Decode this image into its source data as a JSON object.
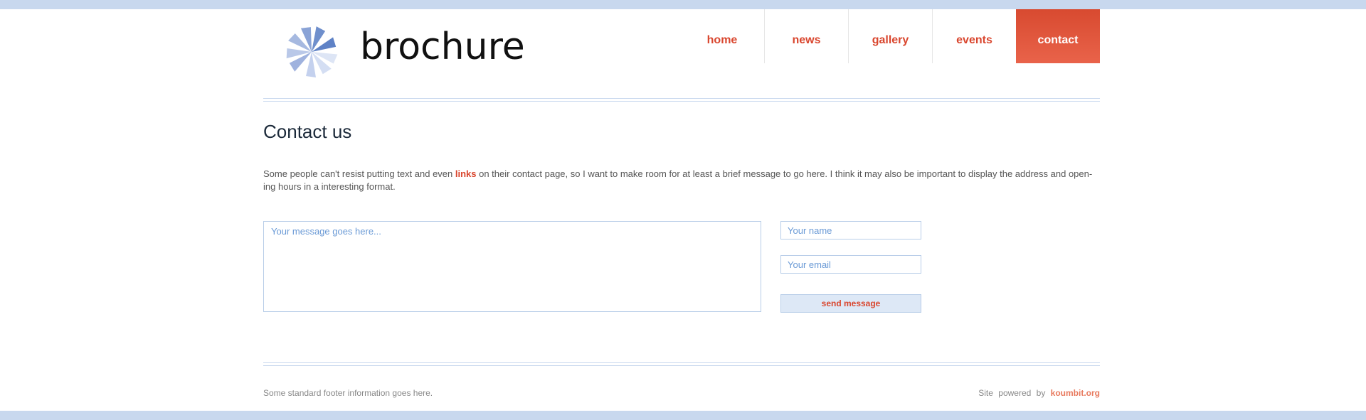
{
  "brand": {
    "name": "brochure"
  },
  "nav": {
    "items": [
      {
        "label": "home"
      },
      {
        "label": "news"
      },
      {
        "label": "gallery"
      },
      {
        "label": "events"
      },
      {
        "label": "contact",
        "active": true
      }
    ]
  },
  "main": {
    "title": "Contact us",
    "intro_before": "Some people can't resist putting text and even ",
    "intro_link": "links",
    "intro_after": " on their contact page, so I want to make room for at least a brief message to go here. I think it may also be important to display the address and open-ing hours in a interesting format."
  },
  "form": {
    "message_placeholder": "Your message goes here...",
    "name_placeholder": "Your name",
    "email_placeholder": "Your email",
    "send_label": "send message"
  },
  "footer": {
    "left_text": "Some standard footer information goes here.",
    "powered_text": "Site powered by",
    "powered_link": "koumbit.org"
  },
  "colors": {
    "accent": "#d9462e",
    "bar": "#c8d8ee",
    "input_text": "#6a9ad6"
  }
}
